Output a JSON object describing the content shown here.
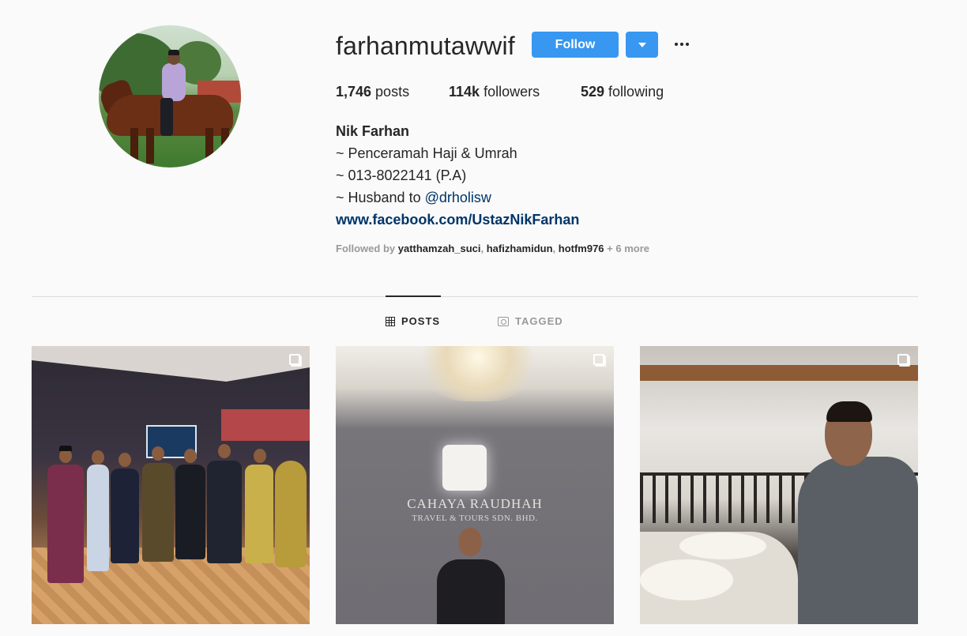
{
  "profile": {
    "username": "farhanmutawwif",
    "follow_label": "Follow",
    "stats": {
      "posts_count": "1,746",
      "posts_label": " posts",
      "followers_count": "114k",
      "followers_label": " followers",
      "following_count": "529",
      "following_label": " following"
    },
    "bio": {
      "name": "Nik Farhan",
      "line1": "~ Penceramah Haji & Umrah",
      "line2": "~ 013-8022141 (P.A)",
      "line3_prefix": "~ Husband to ",
      "line3_mention": "@drholisw",
      "website": "www.facebook.com/UstazNikFarhan"
    },
    "followed_by": {
      "prefix": "Followed by ",
      "users": [
        "yatthamzah_suci",
        "hafizhamidun",
        "hotfm976"
      ],
      "more": " + 6 more"
    }
  },
  "tabs": [
    {
      "label": "POSTS",
      "active": true,
      "icon": "grid-icon"
    },
    {
      "label": "TAGGED",
      "active": false,
      "icon": "tag-icon"
    }
  ],
  "posts": [
    {
      "type": "carousel",
      "icon": "multi-image-icon"
    },
    {
      "type": "carousel",
      "icon": "multi-image-icon",
      "sign_text_1": "CAHAYA RAUDHAH",
      "sign_text_2": "TRAVEL & TOURS SDN. BHD."
    },
    {
      "type": "carousel",
      "icon": "multi-image-icon"
    }
  ],
  "colors": {
    "background": "#fafafa",
    "follow_button": "#3897f0",
    "link": "#003569",
    "muted": "#999999"
  }
}
